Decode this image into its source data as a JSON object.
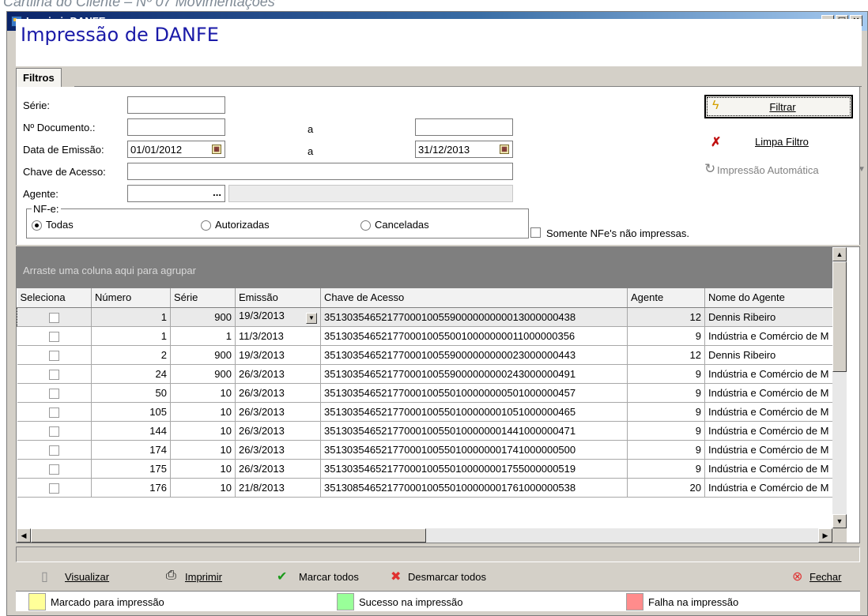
{
  "caption": "Cartilha do Cliente – Nº 07 Movimentações",
  "window": {
    "title": "Imprimir DANFE",
    "min_btn": "_",
    "max_btn": "□",
    "close_btn": "×"
  },
  "header": {
    "title": "Impressão de DANFE"
  },
  "tabs": [
    {
      "label": "Filtros",
      "active": true
    }
  ],
  "filters": {
    "serie_label": "Série:",
    "serie_value": "",
    "doc_label": "Nº Documento.:",
    "doc_from": "",
    "doc_sep": "a",
    "doc_to": "",
    "emissao_label": "Data de Emissão:",
    "emissao_from": "01/01/2012",
    "emissao_sep": "a",
    "emissao_to": "31/12/2013",
    "chave_label": "Chave de Acesso:",
    "chave_value": "",
    "agente_label": "Agente:",
    "agente_value": "",
    "agente_name": "",
    "browse_glyph": "...",
    "nfe_legend": "NF-e:",
    "nfe_options": [
      {
        "label": "Todas",
        "selected": true
      },
      {
        "label": "Autorizadas",
        "selected": false
      },
      {
        "label": "Canceladas",
        "selected": false
      }
    ],
    "somente_label": "Somente NFe's não impressas.",
    "somente_checked": false
  },
  "buttons": {
    "filtrar": "Filtrar",
    "limpa": "Limpa Filtro",
    "auto": "Impressão Automática"
  },
  "grid": {
    "group_hint": "Arraste uma coluna aqui para agrupar",
    "columns": [
      "Seleciona",
      "Número",
      "Série",
      "Emissão",
      "Chave de Acesso",
      "Agente",
      "Nome do Agente"
    ],
    "rows": [
      {
        "numero": "1",
        "serie": "900",
        "emissao": "19/3/2013",
        "chave": "35130354652177000100559000000000013000000438",
        "agente": "12",
        "nome": "Dennis Ribeiro"
      },
      {
        "numero": "1",
        "serie": "1",
        "emissao": "11/3/2013",
        "chave": "35130354652177000100550010000000011000000356",
        "agente": "9",
        "nome": "Indústria e Comércio de M"
      },
      {
        "numero": "2",
        "serie": "900",
        "emissao": "19/3/2013",
        "chave": "35130354652177000100559000000000023000000443",
        "agente": "12",
        "nome": "Dennis Ribeiro"
      },
      {
        "numero": "24",
        "serie": "900",
        "emissao": "26/3/2013",
        "chave": "35130354652177000100559000000000243000000491",
        "agente": "9",
        "nome": "Indústria e Comércio de M"
      },
      {
        "numero": "50",
        "serie": "10",
        "emissao": "26/3/2013",
        "chave": "35130354652177000100550100000000501000000457",
        "agente": "9",
        "nome": "Indústria e Comércio de M"
      },
      {
        "numero": "105",
        "serie": "10",
        "emissao": "26/3/2013",
        "chave": "35130354652177000100550100000001051000000465",
        "agente": "9",
        "nome": "Indústria e Comércio de M"
      },
      {
        "numero": "144",
        "serie": "10",
        "emissao": "26/3/2013",
        "chave": "35130354652177000100550100000001441000000471",
        "agente": "9",
        "nome": "Indústria e Comércio de M"
      },
      {
        "numero": "174",
        "serie": "10",
        "emissao": "26/3/2013",
        "chave": "35130354652177000100550100000001741000000500",
        "agente": "9",
        "nome": "Indústria e Comércio de M"
      },
      {
        "numero": "175",
        "serie": "10",
        "emissao": "26/3/2013",
        "chave": "35130354652177000100550100000001755000000519",
        "agente": "9",
        "nome": "Indústria e Comércio de M"
      },
      {
        "numero": "176",
        "serie": "10",
        "emissao": "21/8/2013",
        "chave": "35130854652177000100550100000001761000000538",
        "agente": "20",
        "nome": "Indústria e Comércio de M"
      }
    ]
  },
  "actions": {
    "visualizar": "Visualizar",
    "imprimir": "Imprimir",
    "marcar": "Marcar todos",
    "desmarcar": "Desmarcar todos",
    "fechar": "Fechar"
  },
  "legend": [
    {
      "label": "Marcado para impressão",
      "color": "#ffff99"
    },
    {
      "label": "Sucesso na impressão",
      "color": "#99ff99"
    },
    {
      "label": "Falha na impressão",
      "color": "#ff8c8c"
    }
  ]
}
